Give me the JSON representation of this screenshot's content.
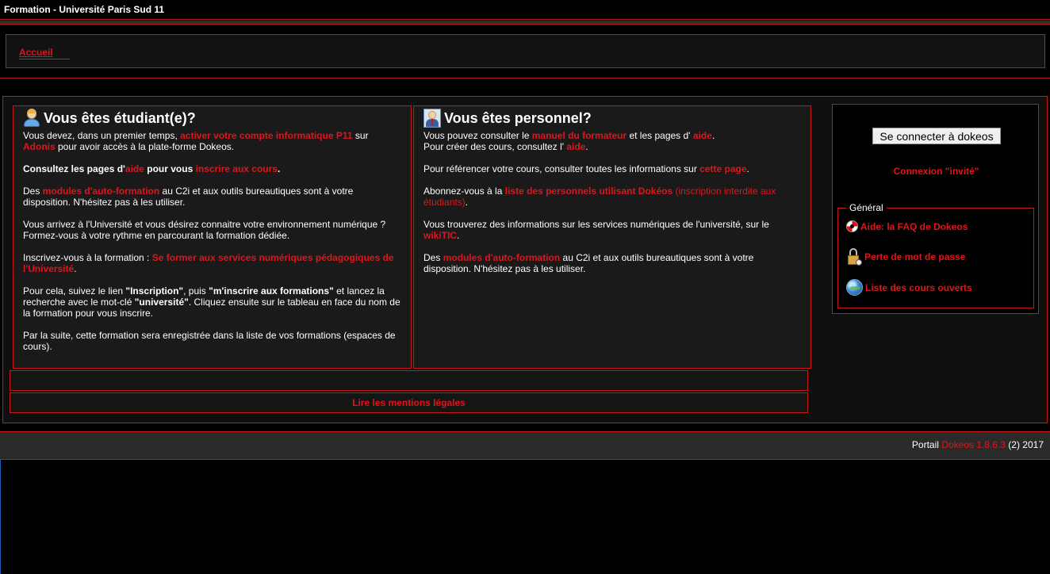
{
  "header": {
    "title": "Formation - Université Paris Sud 11"
  },
  "breadcrumb": {
    "home": "Accueil"
  },
  "students": {
    "title": "Vous êtes étudiant(e)?",
    "p1_a": "Vous devez, dans un premier temps, ",
    "p1_link1": "activer votre compte informatique P11",
    "p1_b": " sur ",
    "p1_link2": "Adonis",
    "p1_c": " pour avoir accès à la plate-forme Dokeos.",
    "p2_a": "Consultez les pages d'",
    "p2_link1": "aide",
    "p2_b": " pour vous ",
    "p2_link2": "inscrire aux cours",
    "p2_c": ".",
    "p3_a": "Des ",
    "p3_link": "modules d'auto-formation",
    "p3_b": " au C2i et aux outils bureautiques sont à votre disposition. N'hésitez pas à les utiliser.",
    "p4": "Vous arrivez à l'Université et vous désirez connaitre votre environnement numérique ? Formez-vous à votre rythme en parcourant la formation dédiée.",
    "p5_a": "Inscrivez-vous à la formation : ",
    "p5_link": "Se former aux services numériques pédagogiques de l'Université",
    "p5_b": ".",
    "p6_a": "Pour cela, suivez le lien ",
    "p6_q1": "\"Inscription\"",
    "p6_b": ", puis ",
    "p6_q2": "\"m'inscrire aux formations\"",
    "p6_c": " et lancez la recherche avec le mot-clé ",
    "p6_q3": "\"université\"",
    "p6_d": ". Cliquez ensuite sur le tableau en face du nom de la formation pour vous inscrire.",
    "p7": "Par la suite, cette formation sera enregistrée dans la liste de vos formations (espaces de cours)."
  },
  "staff": {
    "title": "Vous êtes personnel?",
    "p1_a": "Vous pouvez consulter le ",
    "p1_link1": "manuel du formateur",
    "p1_b": " et les pages d' ",
    "p1_link2": "aide",
    "p1_c": ".",
    "p1_d": "Pour créer des cours, consultez l' ",
    "p1_link3": "aide",
    "p1_e": ".",
    "p2_a": "Pour référencer votre cours, consulter toutes les informations sur ",
    "p2_link": "cette page",
    "p2_b": ".",
    "p3_a": "Abonnez-vous à la ",
    "p3_link": "liste des personnels utilisant Dokéos",
    "p3_note": " (inscription interdite aux étudiants)",
    "p3_b": ".",
    "p4_a": "Vous trouverez des informations sur les services numériques de l'université, sur le ",
    "p4_link": "wikiTIC",
    "p4_b": ".",
    "p5_a": "Des ",
    "p5_link": "modules d'auto-formation",
    "p5_b": " au C2i et aux outils bureautiques sont à votre disposition. N'hésitez pas à les utiliser."
  },
  "legal": {
    "label": "Lire les mentions légales"
  },
  "sidebar": {
    "connect_button": "Se connecter à dokeos",
    "guest_link": "Connexion \"invité\"",
    "general_legend": "Général",
    "items": [
      {
        "label": "Aide: la FAQ de Dokeos",
        "icon": "lifebuoy-icon"
      },
      {
        "label": "Perte de mot de passe",
        "icon": "lock-icon"
      },
      {
        "label": "Liste des cours ouverts",
        "icon": "globe-icon"
      }
    ]
  },
  "footer": {
    "prefix": "Portail ",
    "link": "Dokeos 1.8.6.3",
    "suffix": " (2) 2017"
  },
  "colors": {
    "accent": "#e0151b",
    "border": "#c8161c",
    "background": "#000000"
  }
}
